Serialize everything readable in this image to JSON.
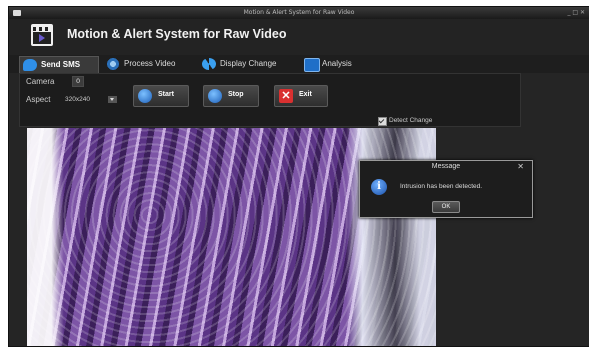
{
  "window": {
    "title": "Motion & Alert System for Raw Video",
    "controls": "_ □ ✕"
  },
  "header": {
    "app_icon": "clapperboard-video-icon",
    "title": "Motion & Alert System for Raw Video"
  },
  "tabs": [
    {
      "label": "Send SMS",
      "icon": "sms-bubble-icon",
      "active": true
    },
    {
      "label": "Process Video",
      "icon": "gears-icon",
      "active": false
    },
    {
      "label": "Display Change",
      "icon": "refresh-arrows-icon",
      "active": false
    },
    {
      "label": "Analysis",
      "icon": "monitor-chart-icon",
      "active": false
    }
  ],
  "controls": {
    "camera_label": "Camera",
    "camera_value": "0",
    "aspect_label": "Aspect",
    "aspect_value": "320x240",
    "start_label": "Start",
    "stop_label": "Stop",
    "exit_label": "Exit",
    "detect_change_label": "Detect Change",
    "detect_change_checked": true
  },
  "dialog": {
    "title": "Message",
    "message": "Intrusion has been detected.",
    "ok_label": "OK",
    "icon": "info-icon"
  },
  "colors": {
    "window_bg": "#252525",
    "accent_blue": "#2f7de1",
    "exit_red": "#d93030"
  }
}
